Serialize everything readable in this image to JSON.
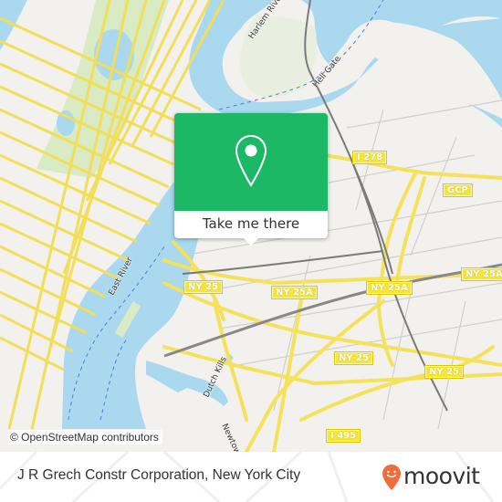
{
  "map": {
    "road_labels": [
      {
        "id": "i278",
        "text": "I 278"
      },
      {
        "id": "gcp",
        "text": "GCP"
      },
      {
        "id": "ny25a-east",
        "text": "NY 25A"
      },
      {
        "id": "ny25-west",
        "text": "NY 25"
      },
      {
        "id": "ny25a-mid",
        "text": "NY 25A"
      },
      {
        "id": "ny25a-right",
        "text": "NY 25A"
      },
      {
        "id": "ny25-mid",
        "text": "NY 25"
      },
      {
        "id": "ny25-right",
        "text": "NY 25"
      },
      {
        "id": "i495",
        "text": "I 495"
      }
    ],
    "water_labels": [
      {
        "id": "harlem-river",
        "text": "Harlem River"
      },
      {
        "id": "hell-gate",
        "text": "Hell Gate"
      },
      {
        "id": "east-river",
        "text": "East River"
      },
      {
        "id": "dutch-kills",
        "text": "Dutch Kills"
      },
      {
        "id": "newtown",
        "text": "Newtown"
      }
    ],
    "colors": {
      "water": "#a9d8ef",
      "park": "#d8ebc4",
      "land": "#f2f1ed",
      "major_road": "#f6e15a",
      "rail": "#7a7a7a"
    },
    "attribution": "© OpenStreetMap contributors"
  },
  "popup": {
    "icon": "location-pin-icon",
    "button_label": "Take me there",
    "accent_color": "#1db866"
  },
  "footer": {
    "place_title": "J R Grech Constr Corporation, New York City",
    "brand": "moovit",
    "brand_color": "#f26b3a"
  }
}
